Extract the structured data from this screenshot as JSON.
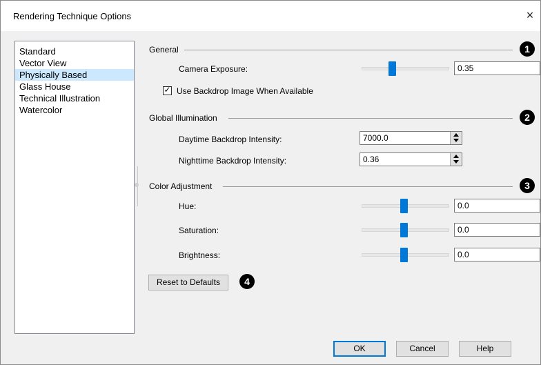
{
  "window": {
    "title": "Rendering Technique Options",
    "close_symbol": "×"
  },
  "techniques": [
    "Standard",
    "Vector View",
    "Physically Based",
    "Glass House",
    "Technical Illustration",
    "Watercolor"
  ],
  "selected_technique": "Physically Based",
  "general": {
    "label": "General",
    "marker": "1",
    "camera_exposure_label": "Camera Exposure:",
    "camera_exposure_value": "0.35",
    "use_backdrop_label": "Use Backdrop Image When Available",
    "use_backdrop_checked": true
  },
  "global_illumination": {
    "label": "Global Illumination",
    "marker": "2",
    "daytime_label": "Daytime Backdrop Intensity:",
    "daytime_value": "7000.0",
    "nighttime_label": "Nighttime Backdrop Intensity:",
    "nighttime_value": "0.36"
  },
  "color_adjustment": {
    "label": "Color Adjustment",
    "marker": "3",
    "hue_label": "Hue:",
    "hue_value": "0.0",
    "saturation_label": "Saturation:",
    "saturation_value": "0.0",
    "brightness_label": "Brightness:",
    "brightness_value": "0.0"
  },
  "reset_button": {
    "label": "Reset to Defaults",
    "marker": "4"
  },
  "footer": {
    "ok_label": "OK",
    "cancel_label": "Cancel",
    "help_label": "Help"
  },
  "colors": {
    "accent": "#0078d7",
    "selection": "#cce8ff",
    "dialog_bg": "#f0f0f0"
  }
}
